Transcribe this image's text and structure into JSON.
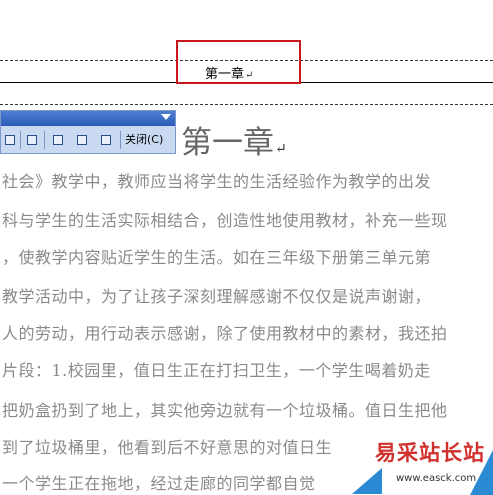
{
  "header": {
    "text": "第一章",
    "paragraph_mark": "↵"
  },
  "toolbar": {
    "close_label": "关闭(C)"
  },
  "document": {
    "chapter_title": "第一章",
    "paragraph_mark": "↵",
    "lines": [
      "社会》教学中，教师应当将学生的生活经验作为教学的出发",
      "科与学生的生活实际相结合，创造性地使用教材，补充一些现",
      "，使教学内容贴近学生的生活。如在三年级下册第三单元第",
      "教学活动中，为了让孩子深刻理解感谢不仅仅是说声谢谢，",
      "人的劳动，用行动表示感谢，除了使用教材中的素材，我还拍",
      "片段：1.校园里，值日生正在打扫卫生，一个学生喝着奶走",
      "把奶盒扔到了地上，其实他旁边就有一个垃圾桶。值日生把他",
      "到了垃圾桶里，他看到后不好意思的对值日生",
      "一个学生正在拖地，经过走廊的同学都自觉"
    ]
  },
  "watermark": {
    "text": "易采站长站",
    "url": "www.easck.com"
  },
  "colors": {
    "highlight": "#c8161d",
    "toolbar_title": "#2a5bb6",
    "watermark": "#d0312d"
  }
}
